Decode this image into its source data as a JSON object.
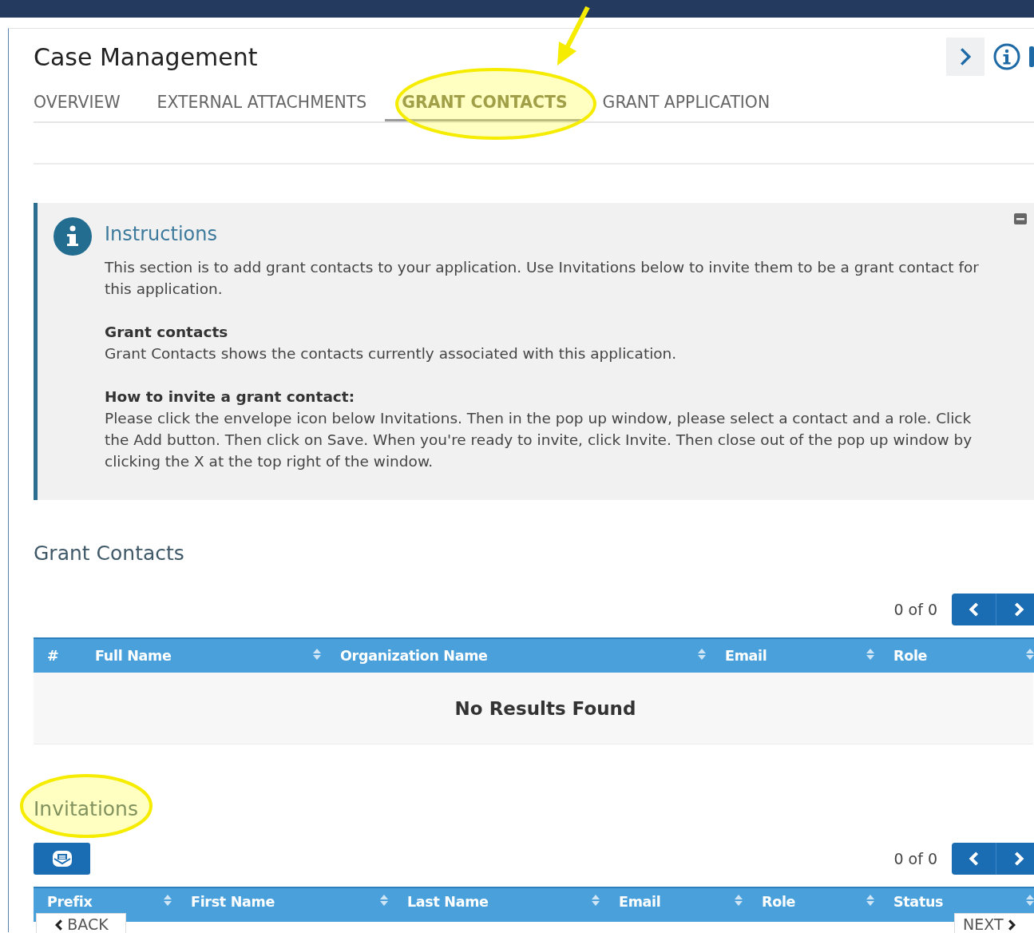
{
  "header": {
    "title": "Case Management"
  },
  "tabs": [
    {
      "label": "OVERVIEW",
      "selected": false
    },
    {
      "label": "EXTERNAL ATTACHMENTS",
      "selected": false
    },
    {
      "label": "GRANT CONTACTS",
      "selected": true
    },
    {
      "label": "GRANT APPLICATION",
      "selected": false
    }
  ],
  "instructions": {
    "title": "Instructions",
    "intro": "This section is to add grant contacts to your application. Use Invitations below to invite them to be a grant contact for this application.",
    "sections": [
      {
        "heading": "Grant contacts",
        "text": "Grant Contacts shows the contacts currently associated with this application."
      },
      {
        "heading": "How to invite a grant contact:",
        "text": "Please click the envelope icon below Invitations. Then in the pop up window, please select a contact and a role. Click the Add button. Then click on Save. When you're ready to invite, click Invite. Then close out of the pop up window by clicking the X at the top right of the window."
      }
    ]
  },
  "grant_contacts": {
    "title": "Grant Contacts",
    "pager": "0 of 0",
    "empty": "No Results Found",
    "columns": [
      {
        "label": "#",
        "sortable": false
      },
      {
        "label": "Full Name",
        "sortable": true
      },
      {
        "label": "Organization Name",
        "sortable": true
      },
      {
        "label": "Email",
        "sortable": true
      },
      {
        "label": "Role",
        "sortable": true
      }
    ]
  },
  "invitations": {
    "title": "Invitations",
    "pager": "0 of 0",
    "columns": [
      {
        "label": "Prefix",
        "sortable": true
      },
      {
        "label": "First Name",
        "sortable": true
      },
      {
        "label": "Last Name",
        "sortable": true
      },
      {
        "label": "Email",
        "sortable": true
      },
      {
        "label": "Role",
        "sortable": true
      },
      {
        "label": "Status",
        "sortable": true
      }
    ]
  },
  "footer": {
    "back": "BACK",
    "next": "NEXT"
  }
}
